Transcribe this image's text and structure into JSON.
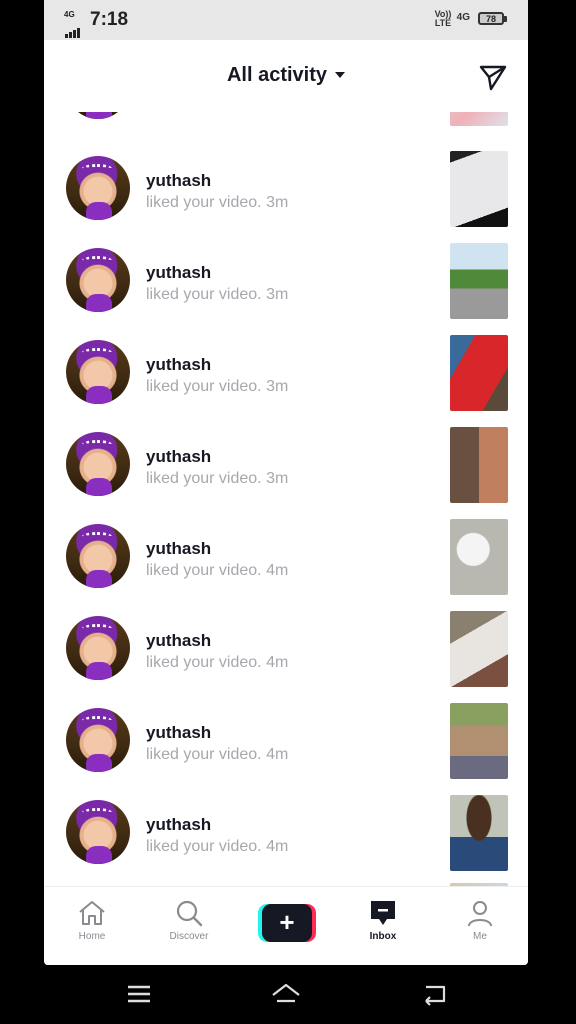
{
  "status_bar": {
    "network_label": "4G",
    "time": "7:18",
    "volte_label": "Vo)) LTE",
    "data_label": "4G",
    "battery": "78"
  },
  "header": {
    "title": "All activity",
    "send_icon": "send-icon"
  },
  "activities": [
    {
      "username": "yuthash",
      "action": "liked your video. 3m"
    },
    {
      "username": "yuthash",
      "action": "liked your video. 3m"
    },
    {
      "username": "yuthash",
      "action": "liked your video. 3m"
    },
    {
      "username": "yuthash",
      "action": "liked your video. 3m"
    },
    {
      "username": "yuthash",
      "action": "liked your video. 4m"
    },
    {
      "username": "yuthash",
      "action": "liked your video. 4m"
    },
    {
      "username": "yuthash",
      "action": "liked your video. 4m"
    },
    {
      "username": "yuthash",
      "action": "liked your video. 4m"
    }
  ],
  "tab_bar": {
    "home": "Home",
    "discover": "Discover",
    "create": "+",
    "inbox": "Inbox",
    "me": "Me",
    "active": "Inbox"
  },
  "colors": {
    "text_primary": "#161823",
    "text_secondary": "#a7a8ad",
    "accent_cyan": "#25f4ee",
    "accent_red": "#fe2c55"
  }
}
